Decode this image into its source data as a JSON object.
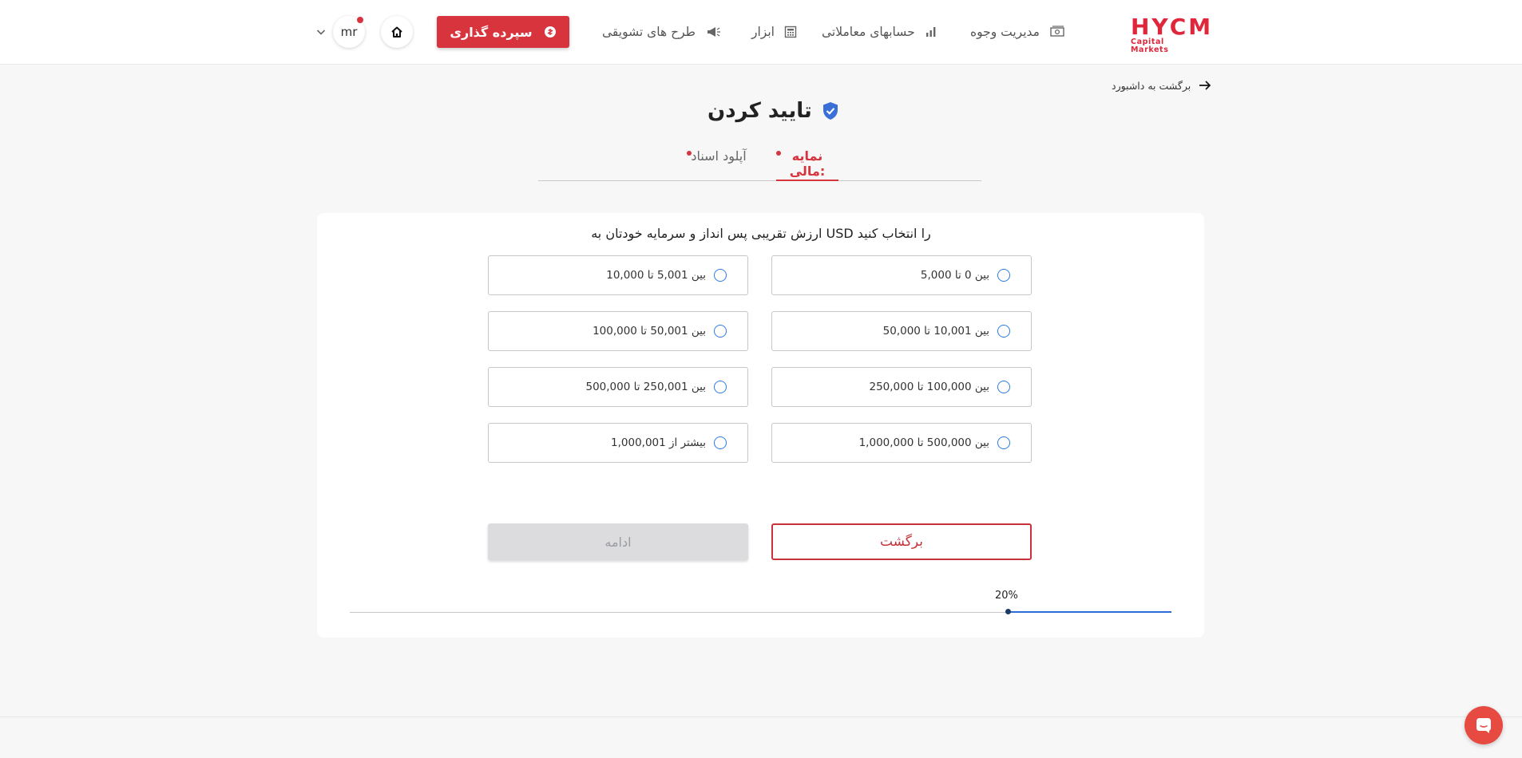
{
  "brand": {
    "logo_main": "HYCM",
    "logo_sub": "Capital Markets",
    "accent": "#d8343d",
    "radio_color": "#2c7be5",
    "progress_color": "#2a6bd6"
  },
  "nav": {
    "funds": "مدیریت وجوه",
    "accounts": "حسابهای معاملاتی",
    "tools": "ابزار",
    "promotions": "طرح های تشویقی",
    "deposit": "سپرده گذاری",
    "avatar": "mr"
  },
  "page": {
    "back_link": "برگشت به داشبورد",
    "title": "تایید کردن",
    "tabs": {
      "financial": "نمایه مالی:",
      "documents": "آپلود اسناد"
    },
    "question": "ارزش تقریبی پس انداز و سرمایه خودتان به USD را انتخاب کنید",
    "options": [
      "بین 0 تا 5,000",
      "بین 5,001 تا 10,000",
      "بین 10,001 تا 50,000",
      "بین 50,001 تا 100,000",
      "بین 100,000 تا 250,000",
      "بین 250,001 تا 500,000",
      "بین 500,000 تا 1,000,000",
      "1,000,001 بیشتر از"
    ],
    "back_button": "برگشت",
    "continue_button": "ادامه",
    "progress_label": "20%",
    "progress_value": 0.2
  },
  "icons": [
    "money-icon",
    "chart-icon",
    "calculator-icon",
    "megaphone-icon",
    "deposit-coin-icon",
    "home-icon",
    "chevron-down-icon",
    "arrow-right-icon",
    "verified-shield-icon",
    "chat-icon"
  ]
}
